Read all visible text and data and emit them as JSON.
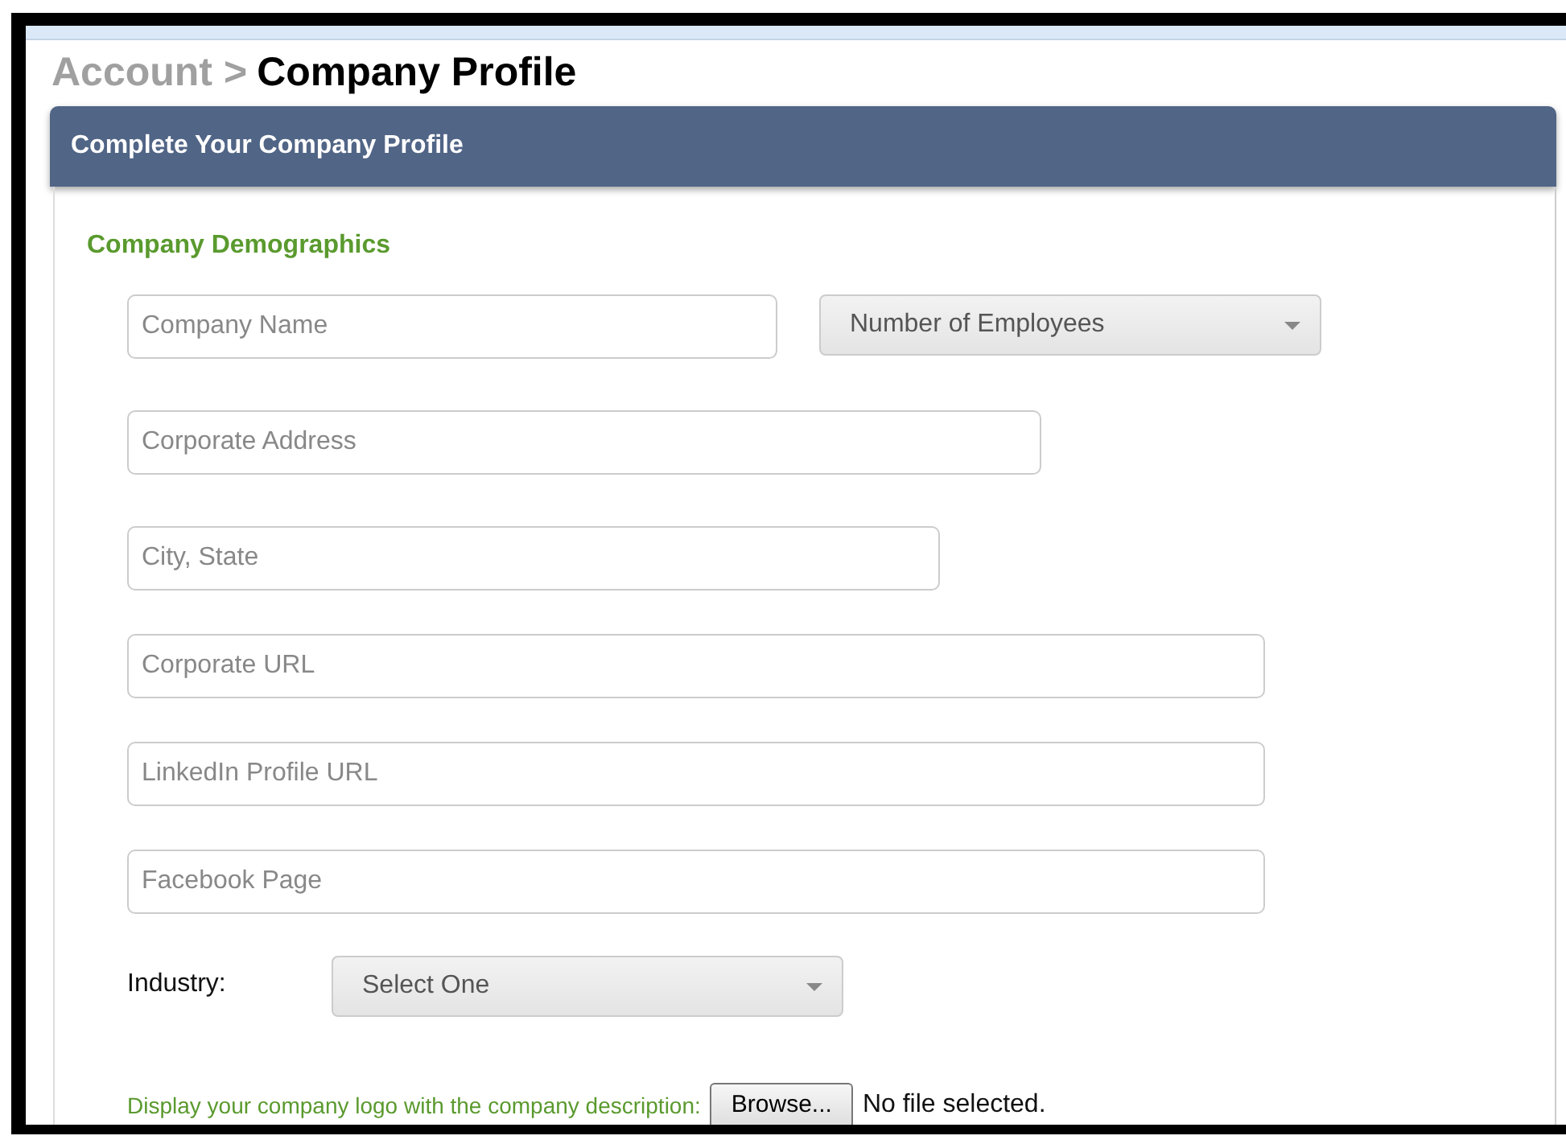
{
  "breadcrumb": {
    "parent": "Account",
    "separator": ">",
    "current": "Company Profile"
  },
  "panel": {
    "title": "Complete Your Company Profile",
    "section": "Company Demographics"
  },
  "rows": [
    [
      {
        "kind": "text",
        "placeholder": "Company Name"
      },
      {
        "kind": "select",
        "value": "Number of Employees"
      }
    ],
    [
      {
        "kind": "text",
        "placeholder": "Corporate Address"
      }
    ],
    [
      {
        "kind": "text",
        "placeholder": "City, State"
      }
    ],
    [
      {
        "kind": "text",
        "placeholder": "Corporate URL"
      }
    ],
    [
      {
        "kind": "text",
        "placeholder": "LinkedIn Profile URL"
      }
    ],
    [
      {
        "kind": "text",
        "placeholder": "Facebook Page"
      }
    ]
  ],
  "industry": {
    "label": "Industry:",
    "value": "Select One"
  },
  "logo": {
    "label": "Display your company logo with the company description:",
    "button": "Browse...",
    "status": "No file selected."
  }
}
